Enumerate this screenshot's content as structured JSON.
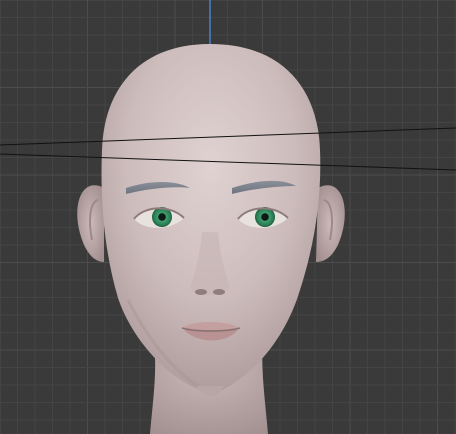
{
  "viewport": {
    "background_color": "#3a3a3a",
    "grid_minor_color": "#444444",
    "grid_major_color": "#4c4c4c",
    "axis_z_color": "#4a7fd1",
    "cutting_line_color": "#111111"
  },
  "model": {
    "skin_light": "#d7c7c7",
    "skin_mid": "#bfaeae",
    "skin_dark": "#9f8c8c",
    "eyebrow_color": "#7f8490",
    "iris_color": "#2f8f5f",
    "iris_dark": "#1b5a3c",
    "pupil_color": "#0d1b14",
    "sclera_color": "#e8e2df",
    "lip_color": "#c49f9f"
  }
}
